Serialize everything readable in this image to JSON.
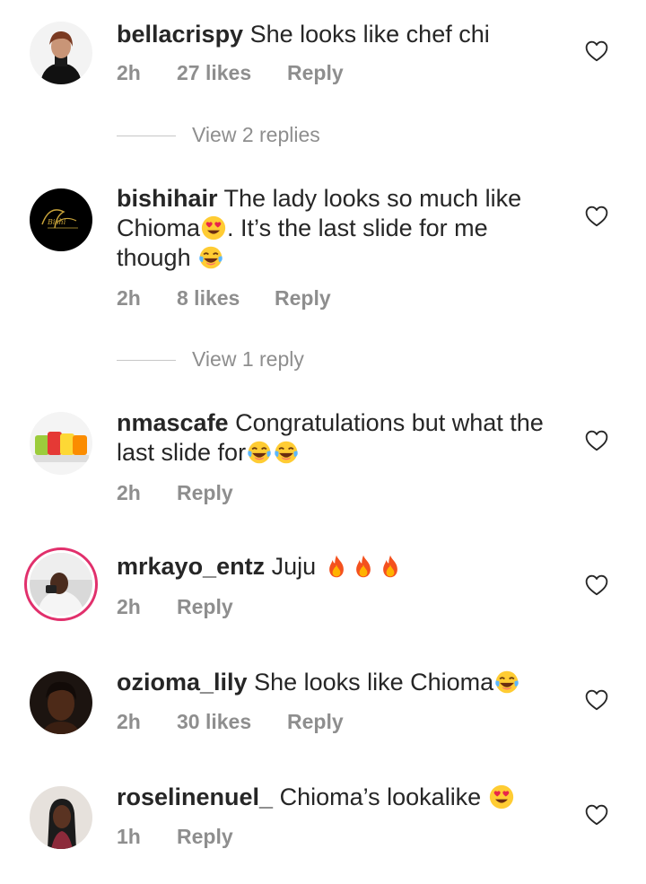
{
  "comments": [
    {
      "username": "bellacrispy",
      "text": "She looks like chef chi",
      "time": "2h",
      "likes": "27 likes",
      "reply": "Reply",
      "avatar": "woman-in-black-icon",
      "view_replies": "View 2 replies"
    },
    {
      "username": "bishihair",
      "text_1": "The lady looks so much like Chioma",
      "text_2": ". It’s the last slide for me though",
      "time": "2h",
      "likes": "8 likes",
      "reply": "Reply",
      "avatar": "bishi-hair-logo-icon",
      "view_replies": "View 1 reply"
    },
    {
      "username": "nmascafe",
      "text": "Congratulations but what the last slide for",
      "time": "2h",
      "reply": "Reply",
      "avatar": "fruit-cups-icon"
    },
    {
      "username": "mrkayo_entz",
      "text": "Juju",
      "time": "2h",
      "reply": "Reply",
      "avatar": "man-in-car-icon"
    },
    {
      "username": "ozioma_lily",
      "text": "She looks like Chioma",
      "time": "2h",
      "likes": "30 likes",
      "reply": "Reply",
      "avatar": "woman-portrait-icon"
    },
    {
      "username": "roselinenuel_",
      "text": "Chioma’s lookalike",
      "time": "1h",
      "reply": "Reply",
      "avatar": "woman-braids-icon"
    }
  ],
  "colors": {
    "text": "#262626",
    "meta": "#8e8e8e",
    "story_ring": "#e1306c"
  }
}
